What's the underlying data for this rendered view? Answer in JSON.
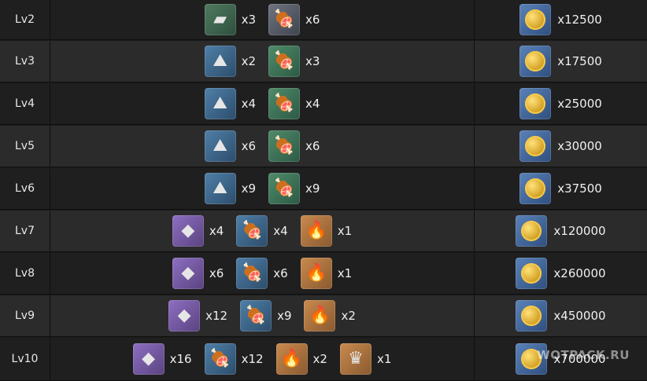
{
  "rows": [
    {
      "level": "Lv2",
      "materials": [
        {
          "icon": "iron-chunk-icon",
          "bg": "bg-brown",
          "glyph": "▰",
          "qty": "x3"
        },
        {
          "icon": "meat-icon",
          "bg": "bg-grey",
          "glyph": "🍖",
          "qty": "x6"
        }
      ],
      "cost": {
        "icon": "gold-coin-icon",
        "qty": "x12500"
      }
    },
    {
      "level": "Lv3",
      "materials": [
        {
          "icon": "steel-icon",
          "bg": "bg-blue",
          "glyph": "⛰",
          "qty": "x2"
        },
        {
          "icon": "meat-icon",
          "bg": "bg-green",
          "glyph": "🍖",
          "qty": "x3"
        }
      ],
      "cost": {
        "icon": "gold-coin-icon",
        "qty": "x17500"
      }
    },
    {
      "level": "Lv4",
      "materials": [
        {
          "icon": "steel-icon",
          "bg": "bg-blue",
          "glyph": "⛰",
          "qty": "x4"
        },
        {
          "icon": "meat-icon",
          "bg": "bg-green",
          "glyph": "🍖",
          "qty": "x4"
        }
      ],
      "cost": {
        "icon": "gold-coin-icon",
        "qty": "x25000"
      }
    },
    {
      "level": "Lv5",
      "materials": [
        {
          "icon": "steel-icon",
          "bg": "bg-blue",
          "glyph": "⛰",
          "qty": "x6"
        },
        {
          "icon": "meat-icon",
          "bg": "bg-green",
          "glyph": "🍖",
          "qty": "x6"
        }
      ],
      "cost": {
        "icon": "gold-coin-icon",
        "qty": "x30000"
      }
    },
    {
      "level": "Lv6",
      "materials": [
        {
          "icon": "steel-icon",
          "bg": "bg-blue",
          "glyph": "⛰",
          "qty": "x9"
        },
        {
          "icon": "meat-icon",
          "bg": "bg-green",
          "glyph": "🍖",
          "qty": "x9"
        }
      ],
      "cost": {
        "icon": "gold-coin-icon",
        "qty": "x37500"
      }
    },
    {
      "level": "Lv7",
      "materials": [
        {
          "icon": "gold-ore-icon",
          "bg": "bg-purple",
          "glyph": "◆",
          "qty": "x4"
        },
        {
          "icon": "dragon-meat-icon",
          "bg": "bg-blue",
          "glyph": "🍖",
          "qty": "x4"
        },
        {
          "icon": "fire-crystal-icon",
          "bg": "bg-orange",
          "glyph": "🔥",
          "qty": "x1"
        }
      ],
      "cost": {
        "icon": "gold-coin-icon",
        "qty": "x120000"
      }
    },
    {
      "level": "Lv8",
      "materials": [
        {
          "icon": "gold-ore-icon",
          "bg": "bg-purple",
          "glyph": "◆",
          "qty": "x6"
        },
        {
          "icon": "dragon-meat-icon",
          "bg": "bg-blue",
          "glyph": "🍖",
          "qty": "x6"
        },
        {
          "icon": "fire-crystal-icon",
          "bg": "bg-orange",
          "glyph": "🔥",
          "qty": "x1"
        }
      ],
      "cost": {
        "icon": "gold-coin-icon",
        "qty": "x260000"
      }
    },
    {
      "level": "Lv9",
      "materials": [
        {
          "icon": "gold-ore-icon",
          "bg": "bg-purple",
          "glyph": "◆",
          "qty": "x12"
        },
        {
          "icon": "dragon-meat-icon",
          "bg": "bg-blue",
          "glyph": "🍖",
          "qty": "x9"
        },
        {
          "icon": "fire-crystal-icon",
          "bg": "bg-orange",
          "glyph": "🔥",
          "qty": "x2"
        }
      ],
      "cost": {
        "icon": "gold-coin-icon",
        "qty": "x450000"
      }
    },
    {
      "level": "Lv10",
      "materials": [
        {
          "icon": "gold-ore-icon",
          "bg": "bg-purple",
          "glyph": "◆",
          "qty": "x16"
        },
        {
          "icon": "dragon-meat-icon",
          "bg": "bg-blue",
          "glyph": "🍖",
          "qty": "x12"
        },
        {
          "icon": "fire-crystal-icon",
          "bg": "bg-orange",
          "glyph": "🔥",
          "qty": "x2"
        },
        {
          "icon": "crown-icon",
          "bg": "bg-orange",
          "glyph": "♛",
          "qty": "x1"
        }
      ],
      "cost": {
        "icon": "gold-coin-icon",
        "qty": "x700000"
      }
    }
  ],
  "watermark": "WOTPACK.RU"
}
